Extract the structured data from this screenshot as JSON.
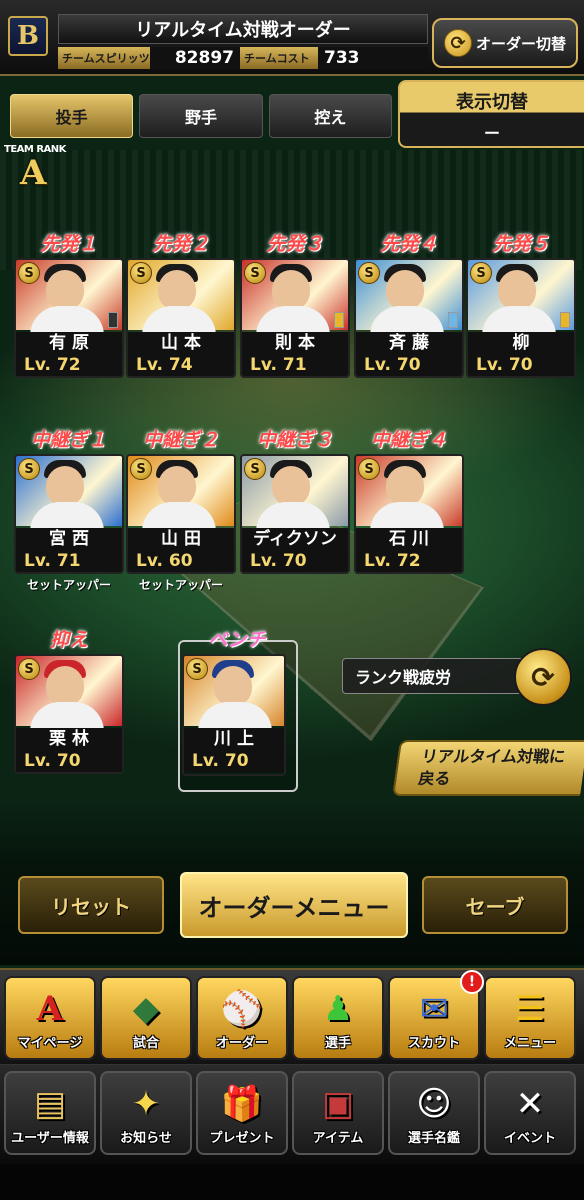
{
  "header": {
    "team_logo": "B",
    "title": "リアルタイム対戦オーダー",
    "spirits_label": "チームスピリッツ",
    "spirits_value": "82897",
    "cost_label": "チームコスト",
    "cost_value": "733",
    "order_switch_label": "オーダー切替"
  },
  "tabs": [
    {
      "label": "投手",
      "active": true
    },
    {
      "label": "野手",
      "active": false
    },
    {
      "label": "控え",
      "active": false
    }
  ],
  "display_switch": {
    "label": "表示切替",
    "value": "ー"
  },
  "team_rank": {
    "label": "TEAM RANK",
    "value": "A"
  },
  "starters": [
    {
      "pos": "先発１",
      "name": "有原",
      "level": "Lv. 72",
      "rank": "S",
      "color": "#c93b2a"
    },
    {
      "pos": "先発２",
      "name": "山本",
      "level": "Lv. 74",
      "rank": "S",
      "color": "#e0a72a"
    },
    {
      "pos": "先発３",
      "name": "則本",
      "level": "Lv. 71",
      "rank": "S",
      "color": "#c9302a"
    },
    {
      "pos": "先発４",
      "name": "斉藤",
      "level": "Lv. 70",
      "rank": "S",
      "color": "#3c8fd6"
    },
    {
      "pos": "先発５",
      "name": "柳",
      "level": "Lv. 70",
      "rank": "S",
      "color": "#5a9ae0"
    }
  ],
  "relievers": [
    {
      "pos": "中継ぎ１",
      "name": "宮西",
      "level": "Lv. 71",
      "rank": "S",
      "color": "#2a6fd0",
      "note": "セットアッパー"
    },
    {
      "pos": "中継ぎ２",
      "name": "山田",
      "level": "Lv. 60",
      "rank": "S",
      "color": "#e08a1a",
      "note": "セットアッパー"
    },
    {
      "pos": "中継ぎ３",
      "name": "ディクソン",
      "level": "Lv. 70",
      "rank": "S",
      "color": "#8a9aa8",
      "note": ""
    },
    {
      "pos": "中継ぎ４",
      "name": "石川",
      "level": "Lv. 72",
      "rank": "S",
      "color": "#c93b2a",
      "note": ""
    }
  ],
  "closer": {
    "pos": "抑え",
    "name": "栗林",
    "level": "Lv. 70",
    "rank": "S",
    "color": "#c9252a"
  },
  "bench": {
    "pos": "ベンチ",
    "name": "川上",
    "level": "Lv. 70",
    "rank": "S",
    "color": "#d6842a"
  },
  "fatigue_label": "ランク戦疲労",
  "back_button": "リアルタイム対戦に戻る",
  "actions": {
    "reset": "リセット",
    "order_menu": "オーダーメニュー",
    "save": "セーブ"
  },
  "menu1": [
    {
      "label": "マイページ",
      "icon": "A",
      "icon_name": "mypage-icon"
    },
    {
      "label": "試合",
      "icon": "◆",
      "icon_name": "stadium-icon"
    },
    {
      "label": "オーダー",
      "icon": "⚾",
      "icon_name": "order-icon"
    },
    {
      "label": "選手",
      "icon": "♟",
      "icon_name": "player-icon"
    },
    {
      "label": "スカウト",
      "icon": "✉",
      "icon_name": "scout-icon",
      "notify": "!"
    },
    {
      "label": "メニュー",
      "icon": "☰",
      "icon_name": "menu-icon"
    }
  ],
  "menu2": [
    {
      "label": "ユーザー情報",
      "icon": "▤",
      "icon_name": "user-info-icon"
    },
    {
      "label": "お知らせ",
      "icon": "✦",
      "icon_name": "news-icon"
    },
    {
      "label": "プレゼント",
      "icon": "🎁",
      "icon_name": "present-icon"
    },
    {
      "label": "アイテム",
      "icon": "▣",
      "icon_name": "item-icon"
    },
    {
      "label": "選手名鑑",
      "icon": "☺",
      "icon_name": "player-book-icon"
    },
    {
      "label": "イベント",
      "icon": "✕",
      "icon_name": "event-icon"
    }
  ]
}
